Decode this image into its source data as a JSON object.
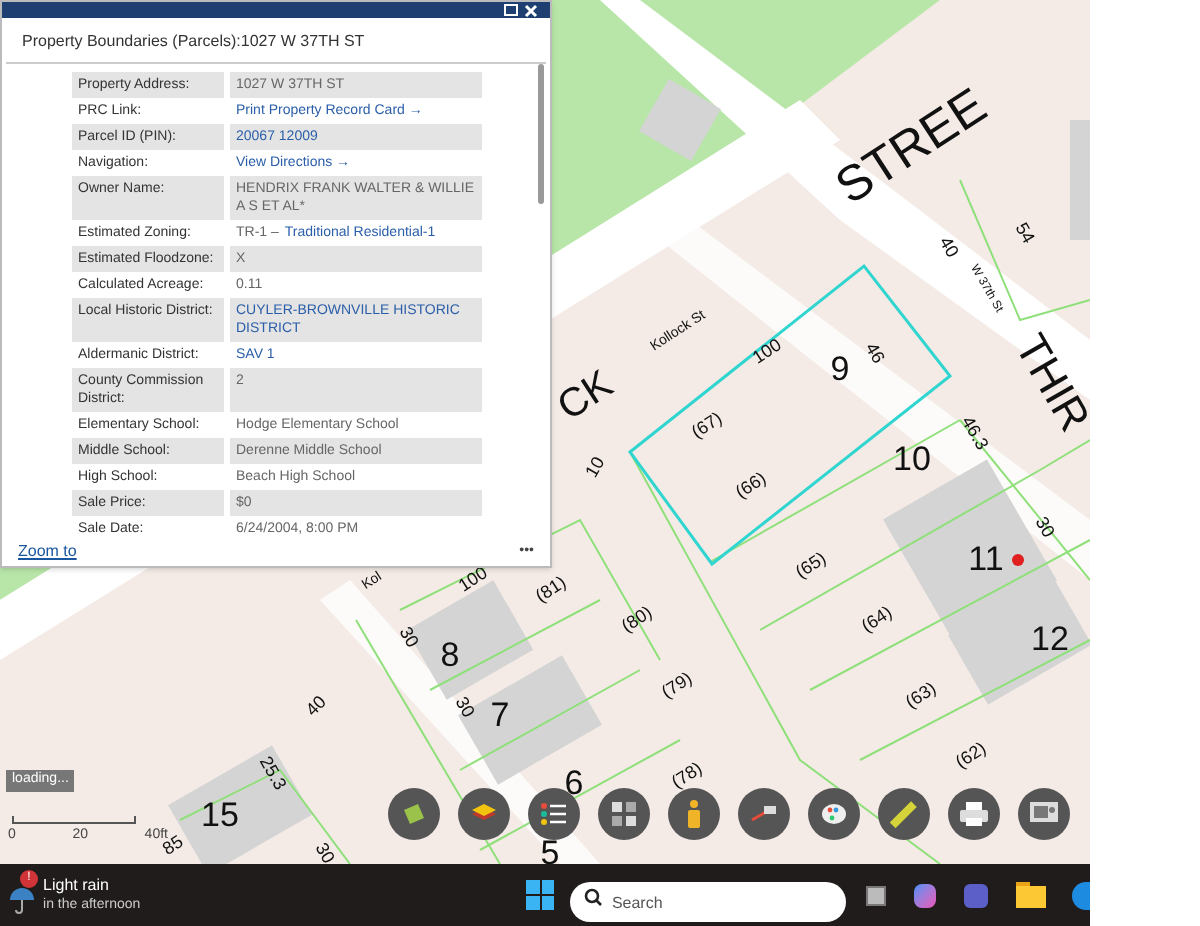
{
  "popup": {
    "title": "Property Boundaries (Parcels):1027 W 37TH ST",
    "zoom_link": "Zoom to",
    "more": "•••",
    "rows": [
      {
        "label": "Property Address:",
        "value": "1027 W 37TH ST",
        "kind": "text"
      },
      {
        "label": "PRC Link:",
        "value": "Print Property Record Card →",
        "kind": "link"
      },
      {
        "label": "Parcel ID (PIN):",
        "value": "20067 12009",
        "kind": "link"
      },
      {
        "label": "Navigation:",
        "value": "View Directions →",
        "kind": "link"
      },
      {
        "label": "Owner Name:",
        "value": "HENDRIX FRANK WALTER & WILLIE A S ET AL*",
        "kind": "text"
      },
      {
        "label": "Estimated Zoning:",
        "value": "TR-1 –",
        "link": "Traditional Residential-1",
        "kind": "mixed"
      },
      {
        "label": "Estimated Floodzone:",
        "value": "X",
        "kind": "text"
      },
      {
        "label": "Calculated Acreage:",
        "value": "0.11",
        "kind": "text"
      },
      {
        "label": "Local Historic District:",
        "value": "CUYLER-BROWNVILLE HISTORIC DISTRICT",
        "kind": "link"
      },
      {
        "label": "Aldermanic District:",
        "value": "SAV 1",
        "kind": "link"
      },
      {
        "label": "County Commission District:",
        "value": "2",
        "kind": "text"
      },
      {
        "label": "Elementary School:",
        "value": "Hodge Elementary School",
        "kind": "text"
      },
      {
        "label": "Middle School:",
        "value": "Derenne Middle School",
        "kind": "text"
      },
      {
        "label": "High School:",
        "value": "Beach High School",
        "kind": "text"
      },
      {
        "label": "Sale Price:",
        "value": "$0",
        "kind": "text"
      },
      {
        "label": "Sale Date:",
        "value": "6/24/2004, 8:00 PM",
        "kind": "text"
      }
    ]
  },
  "map": {
    "labels": [
      "STREE",
      "54",
      "40",
      "W 37th St",
      "Kollock St",
      "100",
      "46",
      "9",
      "THIR",
      "CK",
      "(67)",
      "46.3",
      "10",
      "10",
      "(66)",
      "30",
      "(65)",
      "11",
      "Kol",
      "100",
      "(81)",
      "(80)",
      "(64)",
      "30",
      "8",
      "12",
      "(79)",
      "(63)",
      "40",
      "30",
      "7",
      "(62)",
      "25.3",
      "(78)",
      "6",
      "15",
      "85",
      "30",
      "5"
    ],
    "loading": "loading...",
    "scale": [
      "0",
      "20",
      "40ft"
    ]
  },
  "taskbar": {
    "weather_title": "Light rain",
    "weather_sub": "in the afternoon",
    "badge": "!",
    "search_placeholder": "Search"
  }
}
